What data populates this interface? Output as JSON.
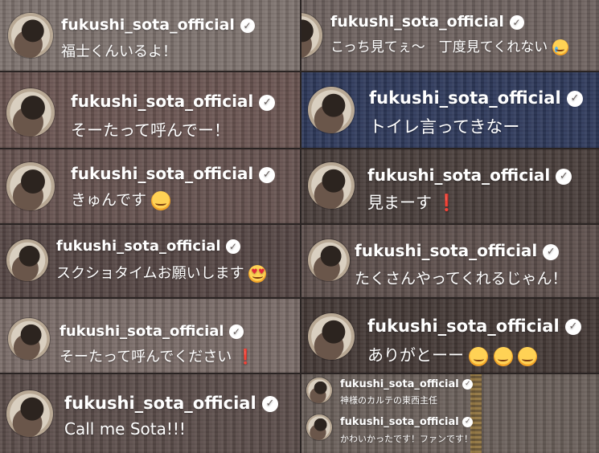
{
  "username": "fukushi_sota_official",
  "verified_mark": "✓",
  "comments": [
    {
      "id": 1,
      "text": "福士くんいるよ！",
      "suffix": ""
    },
    {
      "id": 2,
      "text": "こっち見てぇ〜　丁度見てくれない",
      "suffix": "crying-emoji"
    },
    {
      "id": 3,
      "text": "そーたって呼んでー！",
      "suffix": ""
    },
    {
      "id": 4,
      "text": "トイレ言ってきなー",
      "suffix": ""
    },
    {
      "id": 5,
      "text": "きゅんです",
      "suffix": "smiling-hearts-emoji"
    },
    {
      "id": 6,
      "text": "見まーす",
      "suffix": "red-exclamation"
    },
    {
      "id": 7,
      "text": "スクショタイムお願いします",
      "suffix": "heart-eyes-emoji"
    },
    {
      "id": 8,
      "text": "たくさんやってくれるじゃん！",
      "suffix": ""
    },
    {
      "id": 9,
      "text": "そーたって呼んでください",
      "suffix": "red-exclamation"
    },
    {
      "id": 10,
      "text": "ありがとーー",
      "suffix": "three-smiling-hearts-emoji"
    },
    {
      "id": 11,
      "text": "Call me Sota!!!",
      "suffix": ""
    },
    {
      "id": 12,
      "text": "神様のカルテの東西主任",
      "suffix": ""
    },
    {
      "id": 13,
      "text": "かわいかったです！ファンです！",
      "suffix": ""
    }
  ],
  "exclaim_glyph": "❗",
  "colors": {
    "sweater_gray": "#7b6e68",
    "sweater_rose": "#6e5552",
    "sweater_navy": "#2f3a5c",
    "sweater_dark": "#3b302c",
    "exclaim_red": "#e02a2a"
  }
}
